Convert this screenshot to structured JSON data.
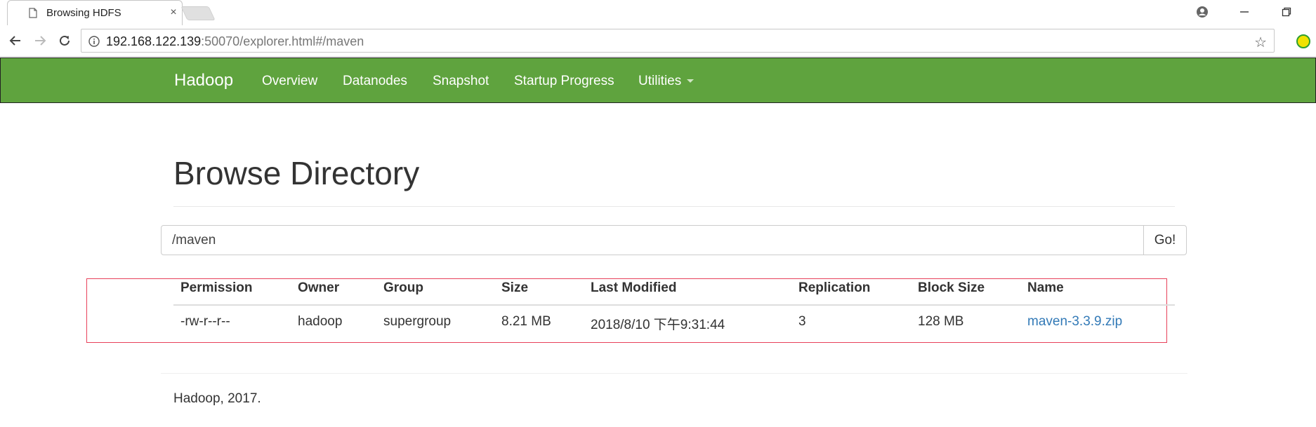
{
  "browser": {
    "tab_title": "Browsing HDFS",
    "tab_close": "×",
    "url_host": "192.168.122.139",
    "url_rest": ":50070/explorer.html#/maven",
    "bookmark_icon": "☆"
  },
  "navbar": {
    "brand": "Hadoop",
    "links": [
      "Overview",
      "Datanodes",
      "Snapshot",
      "Startup Progress",
      "Utilities"
    ],
    "color": "#5fa33e"
  },
  "main": {
    "title": "Browse Directory",
    "path_value": "/maven",
    "go_label": "Go!",
    "table": {
      "headers": [
        "Permission",
        "Owner",
        "Group",
        "Size",
        "Last Modified",
        "Replication",
        "Block Size",
        "Name"
      ],
      "rows": [
        [
          "-rw-r--r--",
          "hadoop",
          "supergroup",
          "8.21 MB",
          "2018/8/10 下午9:31:44",
          "3",
          "128 MB",
          "maven-3.3.9.zip"
        ]
      ]
    },
    "footer": "Hadoop, 2017."
  }
}
